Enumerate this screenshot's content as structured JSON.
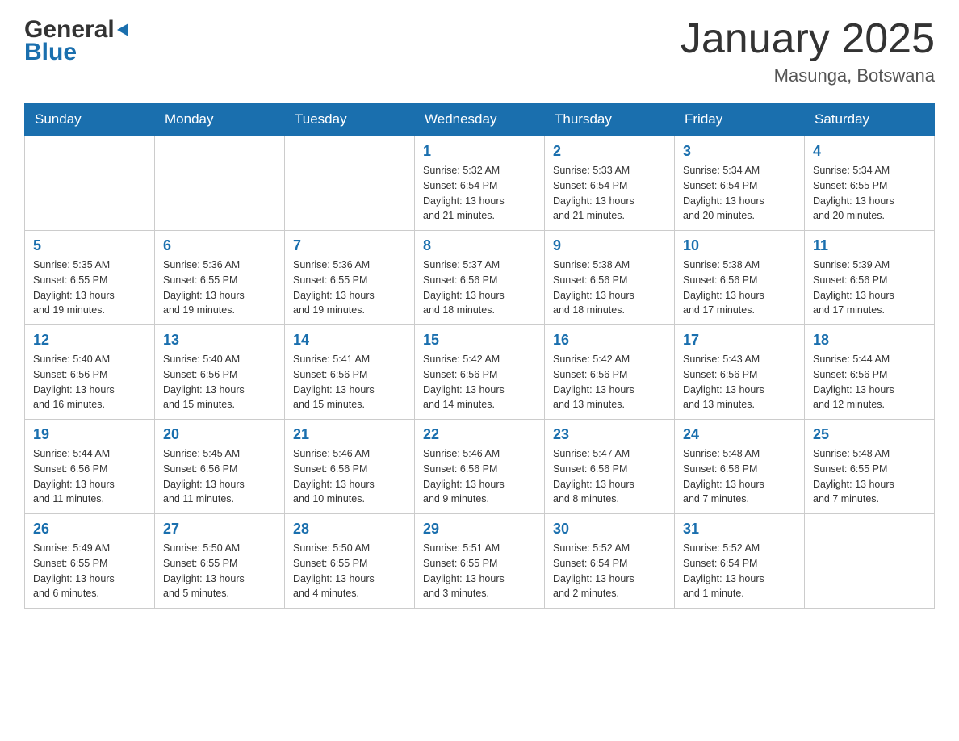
{
  "header": {
    "logo_general": "General",
    "logo_blue": "Blue",
    "title": "January 2025",
    "location": "Masunga, Botswana"
  },
  "days_of_week": [
    "Sunday",
    "Monday",
    "Tuesday",
    "Wednesday",
    "Thursday",
    "Friday",
    "Saturday"
  ],
  "weeks": [
    [
      {
        "day": "",
        "info": ""
      },
      {
        "day": "",
        "info": ""
      },
      {
        "day": "",
        "info": ""
      },
      {
        "day": "1",
        "info": "Sunrise: 5:32 AM\nSunset: 6:54 PM\nDaylight: 13 hours\nand 21 minutes."
      },
      {
        "day": "2",
        "info": "Sunrise: 5:33 AM\nSunset: 6:54 PM\nDaylight: 13 hours\nand 21 minutes."
      },
      {
        "day": "3",
        "info": "Sunrise: 5:34 AM\nSunset: 6:54 PM\nDaylight: 13 hours\nand 20 minutes."
      },
      {
        "day": "4",
        "info": "Sunrise: 5:34 AM\nSunset: 6:55 PM\nDaylight: 13 hours\nand 20 minutes."
      }
    ],
    [
      {
        "day": "5",
        "info": "Sunrise: 5:35 AM\nSunset: 6:55 PM\nDaylight: 13 hours\nand 19 minutes."
      },
      {
        "day": "6",
        "info": "Sunrise: 5:36 AM\nSunset: 6:55 PM\nDaylight: 13 hours\nand 19 minutes."
      },
      {
        "day": "7",
        "info": "Sunrise: 5:36 AM\nSunset: 6:55 PM\nDaylight: 13 hours\nand 19 minutes."
      },
      {
        "day": "8",
        "info": "Sunrise: 5:37 AM\nSunset: 6:56 PM\nDaylight: 13 hours\nand 18 minutes."
      },
      {
        "day": "9",
        "info": "Sunrise: 5:38 AM\nSunset: 6:56 PM\nDaylight: 13 hours\nand 18 minutes."
      },
      {
        "day": "10",
        "info": "Sunrise: 5:38 AM\nSunset: 6:56 PM\nDaylight: 13 hours\nand 17 minutes."
      },
      {
        "day": "11",
        "info": "Sunrise: 5:39 AM\nSunset: 6:56 PM\nDaylight: 13 hours\nand 17 minutes."
      }
    ],
    [
      {
        "day": "12",
        "info": "Sunrise: 5:40 AM\nSunset: 6:56 PM\nDaylight: 13 hours\nand 16 minutes."
      },
      {
        "day": "13",
        "info": "Sunrise: 5:40 AM\nSunset: 6:56 PM\nDaylight: 13 hours\nand 15 minutes."
      },
      {
        "day": "14",
        "info": "Sunrise: 5:41 AM\nSunset: 6:56 PM\nDaylight: 13 hours\nand 15 minutes."
      },
      {
        "day": "15",
        "info": "Sunrise: 5:42 AM\nSunset: 6:56 PM\nDaylight: 13 hours\nand 14 minutes."
      },
      {
        "day": "16",
        "info": "Sunrise: 5:42 AM\nSunset: 6:56 PM\nDaylight: 13 hours\nand 13 minutes."
      },
      {
        "day": "17",
        "info": "Sunrise: 5:43 AM\nSunset: 6:56 PM\nDaylight: 13 hours\nand 13 minutes."
      },
      {
        "day": "18",
        "info": "Sunrise: 5:44 AM\nSunset: 6:56 PM\nDaylight: 13 hours\nand 12 minutes."
      }
    ],
    [
      {
        "day": "19",
        "info": "Sunrise: 5:44 AM\nSunset: 6:56 PM\nDaylight: 13 hours\nand 11 minutes."
      },
      {
        "day": "20",
        "info": "Sunrise: 5:45 AM\nSunset: 6:56 PM\nDaylight: 13 hours\nand 11 minutes."
      },
      {
        "day": "21",
        "info": "Sunrise: 5:46 AM\nSunset: 6:56 PM\nDaylight: 13 hours\nand 10 minutes."
      },
      {
        "day": "22",
        "info": "Sunrise: 5:46 AM\nSunset: 6:56 PM\nDaylight: 13 hours\nand 9 minutes."
      },
      {
        "day": "23",
        "info": "Sunrise: 5:47 AM\nSunset: 6:56 PM\nDaylight: 13 hours\nand 8 minutes."
      },
      {
        "day": "24",
        "info": "Sunrise: 5:48 AM\nSunset: 6:56 PM\nDaylight: 13 hours\nand 7 minutes."
      },
      {
        "day": "25",
        "info": "Sunrise: 5:48 AM\nSunset: 6:55 PM\nDaylight: 13 hours\nand 7 minutes."
      }
    ],
    [
      {
        "day": "26",
        "info": "Sunrise: 5:49 AM\nSunset: 6:55 PM\nDaylight: 13 hours\nand 6 minutes."
      },
      {
        "day": "27",
        "info": "Sunrise: 5:50 AM\nSunset: 6:55 PM\nDaylight: 13 hours\nand 5 minutes."
      },
      {
        "day": "28",
        "info": "Sunrise: 5:50 AM\nSunset: 6:55 PM\nDaylight: 13 hours\nand 4 minutes."
      },
      {
        "day": "29",
        "info": "Sunrise: 5:51 AM\nSunset: 6:55 PM\nDaylight: 13 hours\nand 3 minutes."
      },
      {
        "day": "30",
        "info": "Sunrise: 5:52 AM\nSunset: 6:54 PM\nDaylight: 13 hours\nand 2 minutes."
      },
      {
        "day": "31",
        "info": "Sunrise: 5:52 AM\nSunset: 6:54 PM\nDaylight: 13 hours\nand 1 minute."
      },
      {
        "day": "",
        "info": ""
      }
    ]
  ]
}
